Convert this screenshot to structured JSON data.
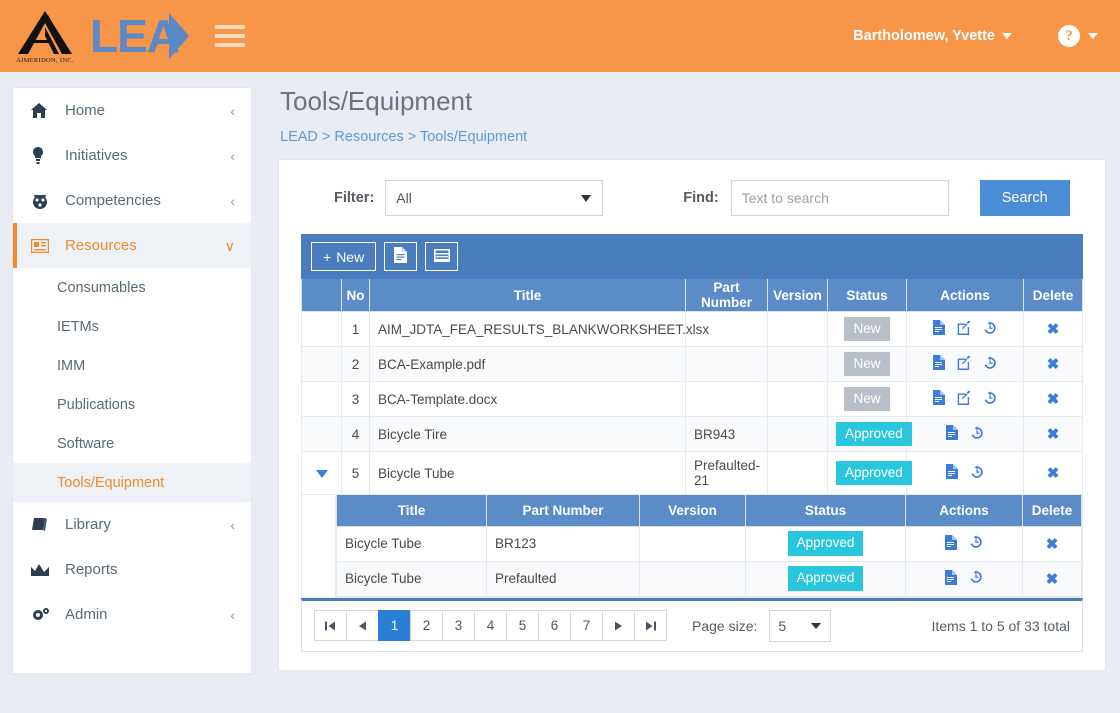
{
  "header": {
    "logo_caption": "AIMERIDON, INC.",
    "brand_word": "LEA",
    "hamburger_icon": "hamburger-menu-icon",
    "user_name": "Bartholomew, Yvette",
    "help_glyph": "?"
  },
  "sidebar": {
    "items": [
      {
        "label": "Home",
        "icon": "home-icon",
        "glyph": "⌂",
        "chevron": "‹",
        "active": false
      },
      {
        "label": "Initiatives",
        "icon": "lightbulb-icon",
        "glyph": "Ὂ1",
        "chevron": "‹",
        "active": false
      },
      {
        "label": "Competencies",
        "icon": "medal-icon",
        "glyph": "☉",
        "chevron": "‹",
        "active": false
      },
      {
        "label": "Resources",
        "icon": "id-card-icon",
        "glyph": "▤",
        "chevron": "∨",
        "active": true
      }
    ],
    "sub_items": [
      {
        "label": "Consumables",
        "active": false
      },
      {
        "label": "IETMs",
        "active": false
      },
      {
        "label": "IMM",
        "active": false
      },
      {
        "label": "Publications",
        "active": false
      },
      {
        "label": "Software",
        "active": false
      },
      {
        "label": "Tools/Equipment",
        "active": true
      }
    ],
    "items_bottom": [
      {
        "label": "Library",
        "icon": "book-icon",
        "glyph": "▧",
        "chevron": "‹"
      },
      {
        "label": "Reports",
        "icon": "chart-icon",
        "glyph": "◢",
        "chevron": ""
      },
      {
        "label": "Admin",
        "icon": "gears-icon",
        "glyph": "⚙",
        "chevron": "‹"
      }
    ]
  },
  "main": {
    "page_title": "Tools/Equipment",
    "breadcrumb": "LEAD > Resources > Tools/Equipment"
  },
  "filter": {
    "filter_label": "Filter:",
    "filter_value": "All",
    "find_label": "Find:",
    "find_value": "",
    "find_placeholder": "Text to search",
    "search_label": "Search"
  },
  "toolbar": {
    "new_label": "New",
    "new_plus": "+",
    "doc_icon": "document-icon",
    "grid_icon": "grid-view-icon"
  },
  "table": {
    "columns": [
      "",
      "No",
      "Title",
      "Part Number",
      "Version",
      "Status",
      "Actions",
      "Delete"
    ],
    "rows": [
      {
        "expand": "",
        "no": "1",
        "title": "AIM_JDTA_FEA_RESULTS_BLANKWORKSHEET.xlsx",
        "part_number": "",
        "version": "",
        "status": "New",
        "status_kind": "new",
        "actions": [
          "document-icon",
          "edit-icon",
          "history-icon"
        ],
        "delete": "✖"
      },
      {
        "expand": "",
        "no": "2",
        "title": "BCA-Example.pdf",
        "part_number": "",
        "version": "",
        "status": "New",
        "status_kind": "new",
        "actions": [
          "document-icon",
          "edit-icon",
          "history-icon"
        ],
        "delete": "✖"
      },
      {
        "expand": "",
        "no": "3",
        "title": "BCA-Template.docx",
        "part_number": "",
        "version": "",
        "status": "New",
        "status_kind": "new",
        "actions": [
          "document-icon",
          "edit-icon",
          "history-icon"
        ],
        "delete": "✖"
      },
      {
        "expand": "",
        "no": "4",
        "title": "Bicycle Tire",
        "part_number": "BR943",
        "version": "",
        "status": "Approved",
        "status_kind": "approved",
        "actions": [
          "document-icon",
          "history-icon"
        ],
        "delete": "✖"
      },
      {
        "expand": "expanded",
        "no": "5",
        "title": "Bicycle Tube",
        "part_number": "Prefaulted-21",
        "version": "",
        "status": "Approved",
        "status_kind": "approved",
        "actions": [
          "document-icon",
          "history-icon"
        ],
        "delete": "✖"
      }
    ]
  },
  "nested_table": {
    "columns": [
      "Title",
      "Part Number",
      "Version",
      "Status",
      "Actions",
      "Delete"
    ],
    "rows": [
      {
        "title": "Bicycle Tube",
        "part_number": "BR123",
        "version": "",
        "status": "Approved",
        "status_kind": "approved",
        "actions": [
          "document-icon",
          "history-icon"
        ],
        "delete": "✖"
      },
      {
        "title": "Bicycle Tube",
        "part_number": "Prefaulted",
        "version": "",
        "status": "Approved",
        "status_kind": "approved",
        "actions": [
          "document-icon",
          "history-icon"
        ],
        "delete": "✖"
      }
    ]
  },
  "pager": {
    "first": "◀❙",
    "prev": "◀",
    "pages": [
      "1",
      "2",
      "3",
      "4",
      "5",
      "6",
      "7"
    ],
    "active_page": "1",
    "next": "▶",
    "last": "❙▶",
    "page_size_label": "Page size:",
    "page_size_value": "5",
    "total_text": "Items 1 to 5 of 33 total"
  },
  "colors": {
    "header_orange": "#f79548",
    "accent_orange": "#f08a2e",
    "brand_blue": "#5b88c6",
    "table_header_blue": "#5b8cc8",
    "toolbar_blue": "#4a7dbd",
    "approved_cyan": "#2ac7dc",
    "new_gray": "#b9bfc7",
    "page_bg": "#e9ecf3"
  }
}
